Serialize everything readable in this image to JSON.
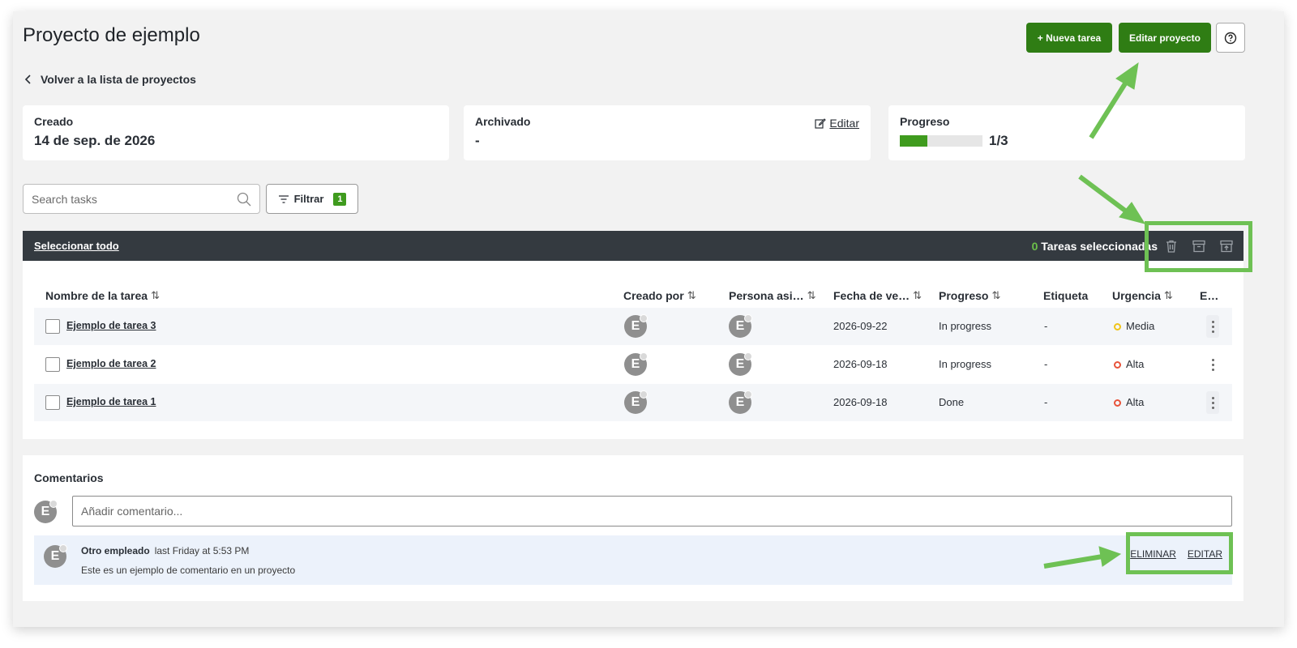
{
  "header": {
    "title": "Proyecto de ejemplo",
    "new_task_label": "+ Nueva tarea",
    "edit_project_label": "Editar proyecto",
    "help_icon": "question-circle-icon"
  },
  "back_link": {
    "label": "Volver a la lista de proyectos",
    "icon": "chevron-left-icon"
  },
  "cards": {
    "created": {
      "label": "Creado",
      "value": "14 de sep. de 2026"
    },
    "archived": {
      "label": "Archivado",
      "value": "-",
      "edit_label": "Editar"
    },
    "progress": {
      "label": "Progreso",
      "value": "1/3",
      "fraction": 0.333
    }
  },
  "toolbar": {
    "search_placeholder": "Search tasks",
    "filter_label": "Filtrar",
    "filter_count": "1"
  },
  "selection_bar": {
    "select_all_label": "Seleccionar todo",
    "selected_count": "0",
    "selected_label": " Tareas seleccionadas",
    "icons": [
      "trash-icon",
      "archive-icon",
      "unarchive-icon"
    ]
  },
  "table": {
    "columns": {
      "name": "Nombre de la tarea",
      "created_by": "Creado por",
      "assignee": "Persona asi…",
      "due_date": "Fecha de ve…",
      "progress": "Progreso",
      "tag": "Etiqueta",
      "urgency": "Urgencia",
      "extra": "E…"
    },
    "rows": [
      {
        "name": "Ejemplo de tarea 3",
        "created_by": "E",
        "assignee": "E",
        "due_date": "2026-09-22",
        "progress": "In progress",
        "tag": "-",
        "urgency": "Media",
        "urgency_color": "#f0c419"
      },
      {
        "name": "Ejemplo de tarea 2",
        "created_by": "E",
        "assignee": "E",
        "due_date": "2026-09-18",
        "progress": "In progress",
        "tag": "-",
        "urgency": "Alta",
        "urgency_color": "#e8533a"
      },
      {
        "name": "Ejemplo de tarea 1",
        "created_by": "E",
        "assignee": "E",
        "due_date": "2026-09-18",
        "progress": "Done",
        "tag": "-",
        "urgency": "Alta",
        "urgency_color": "#e8533a"
      }
    ]
  },
  "comments": {
    "title": "Comentarios",
    "input_placeholder": "Añadir comentario...",
    "avatar_letter": "E",
    "items": [
      {
        "author": "Otro empleado",
        "time": "last Friday at 5:53 PM",
        "text": "Este es un ejemplo de comentario en un proyecto",
        "avatar": "E",
        "delete_label": "ELIMINAR",
        "edit_label": "EDITAR"
      }
    ]
  },
  "colors": {
    "brand_green": "#2f7d14",
    "annotation_green": "#6ec154",
    "dark_bar": "#343a40"
  }
}
